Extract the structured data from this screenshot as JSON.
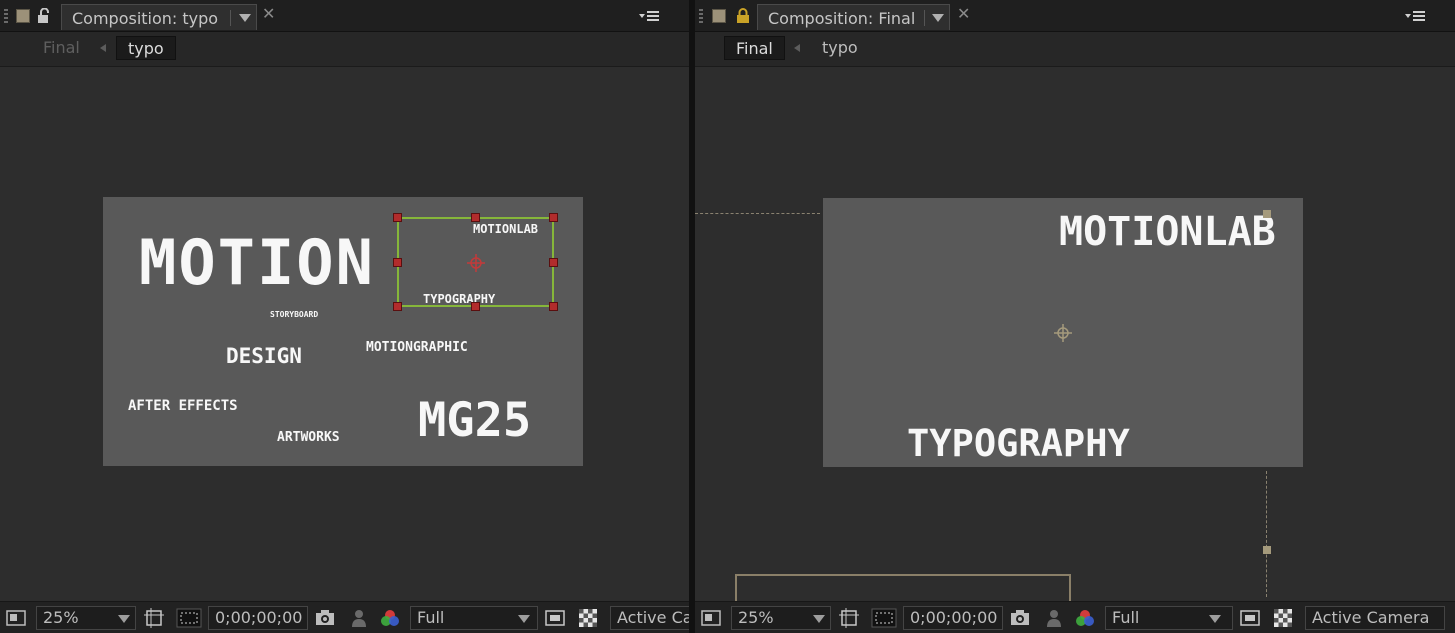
{
  "left_panel": {
    "tab_title": "Composition: typo",
    "breadcrumbs": [
      {
        "label": "Final",
        "state": "dim"
      },
      {
        "label": "typo",
        "state": "active"
      }
    ],
    "comp_words": {
      "motion": "MOTION",
      "motionlab": "MOTIONLAB",
      "typography": "TYPOGRAPHY",
      "storyboard": "STORYBOARD",
      "design": "DESIGN",
      "motiongraphic": "MOTIONGRAPHIC",
      "after_effects": "AFTER EFFECTS",
      "artworks": "ARTWORKS",
      "mg25": "MG25"
    },
    "status": {
      "zoom": "25%",
      "timecode": "0;00;00;00",
      "resolution": "Full",
      "camera": "Active Ca"
    }
  },
  "right_panel": {
    "tab_title": "Composition: Final",
    "breadcrumbs": [
      {
        "label": "Final",
        "state": "active"
      },
      {
        "label": "typo",
        "state": "plain"
      }
    ],
    "comp_words": {
      "motionlab": "MOTIONLAB",
      "typography": "TYPOGRAPHY"
    },
    "status": {
      "zoom": "25%",
      "timecode": "0;00;00;00",
      "resolution": "Full",
      "camera": "Active Camera"
    }
  },
  "colors": {
    "panel_bg": "#2d2d2d",
    "comp_bg": "#595959",
    "selection": "#86b63a",
    "handle": "#b22c2c",
    "label_swatch": "#9c9179"
  }
}
